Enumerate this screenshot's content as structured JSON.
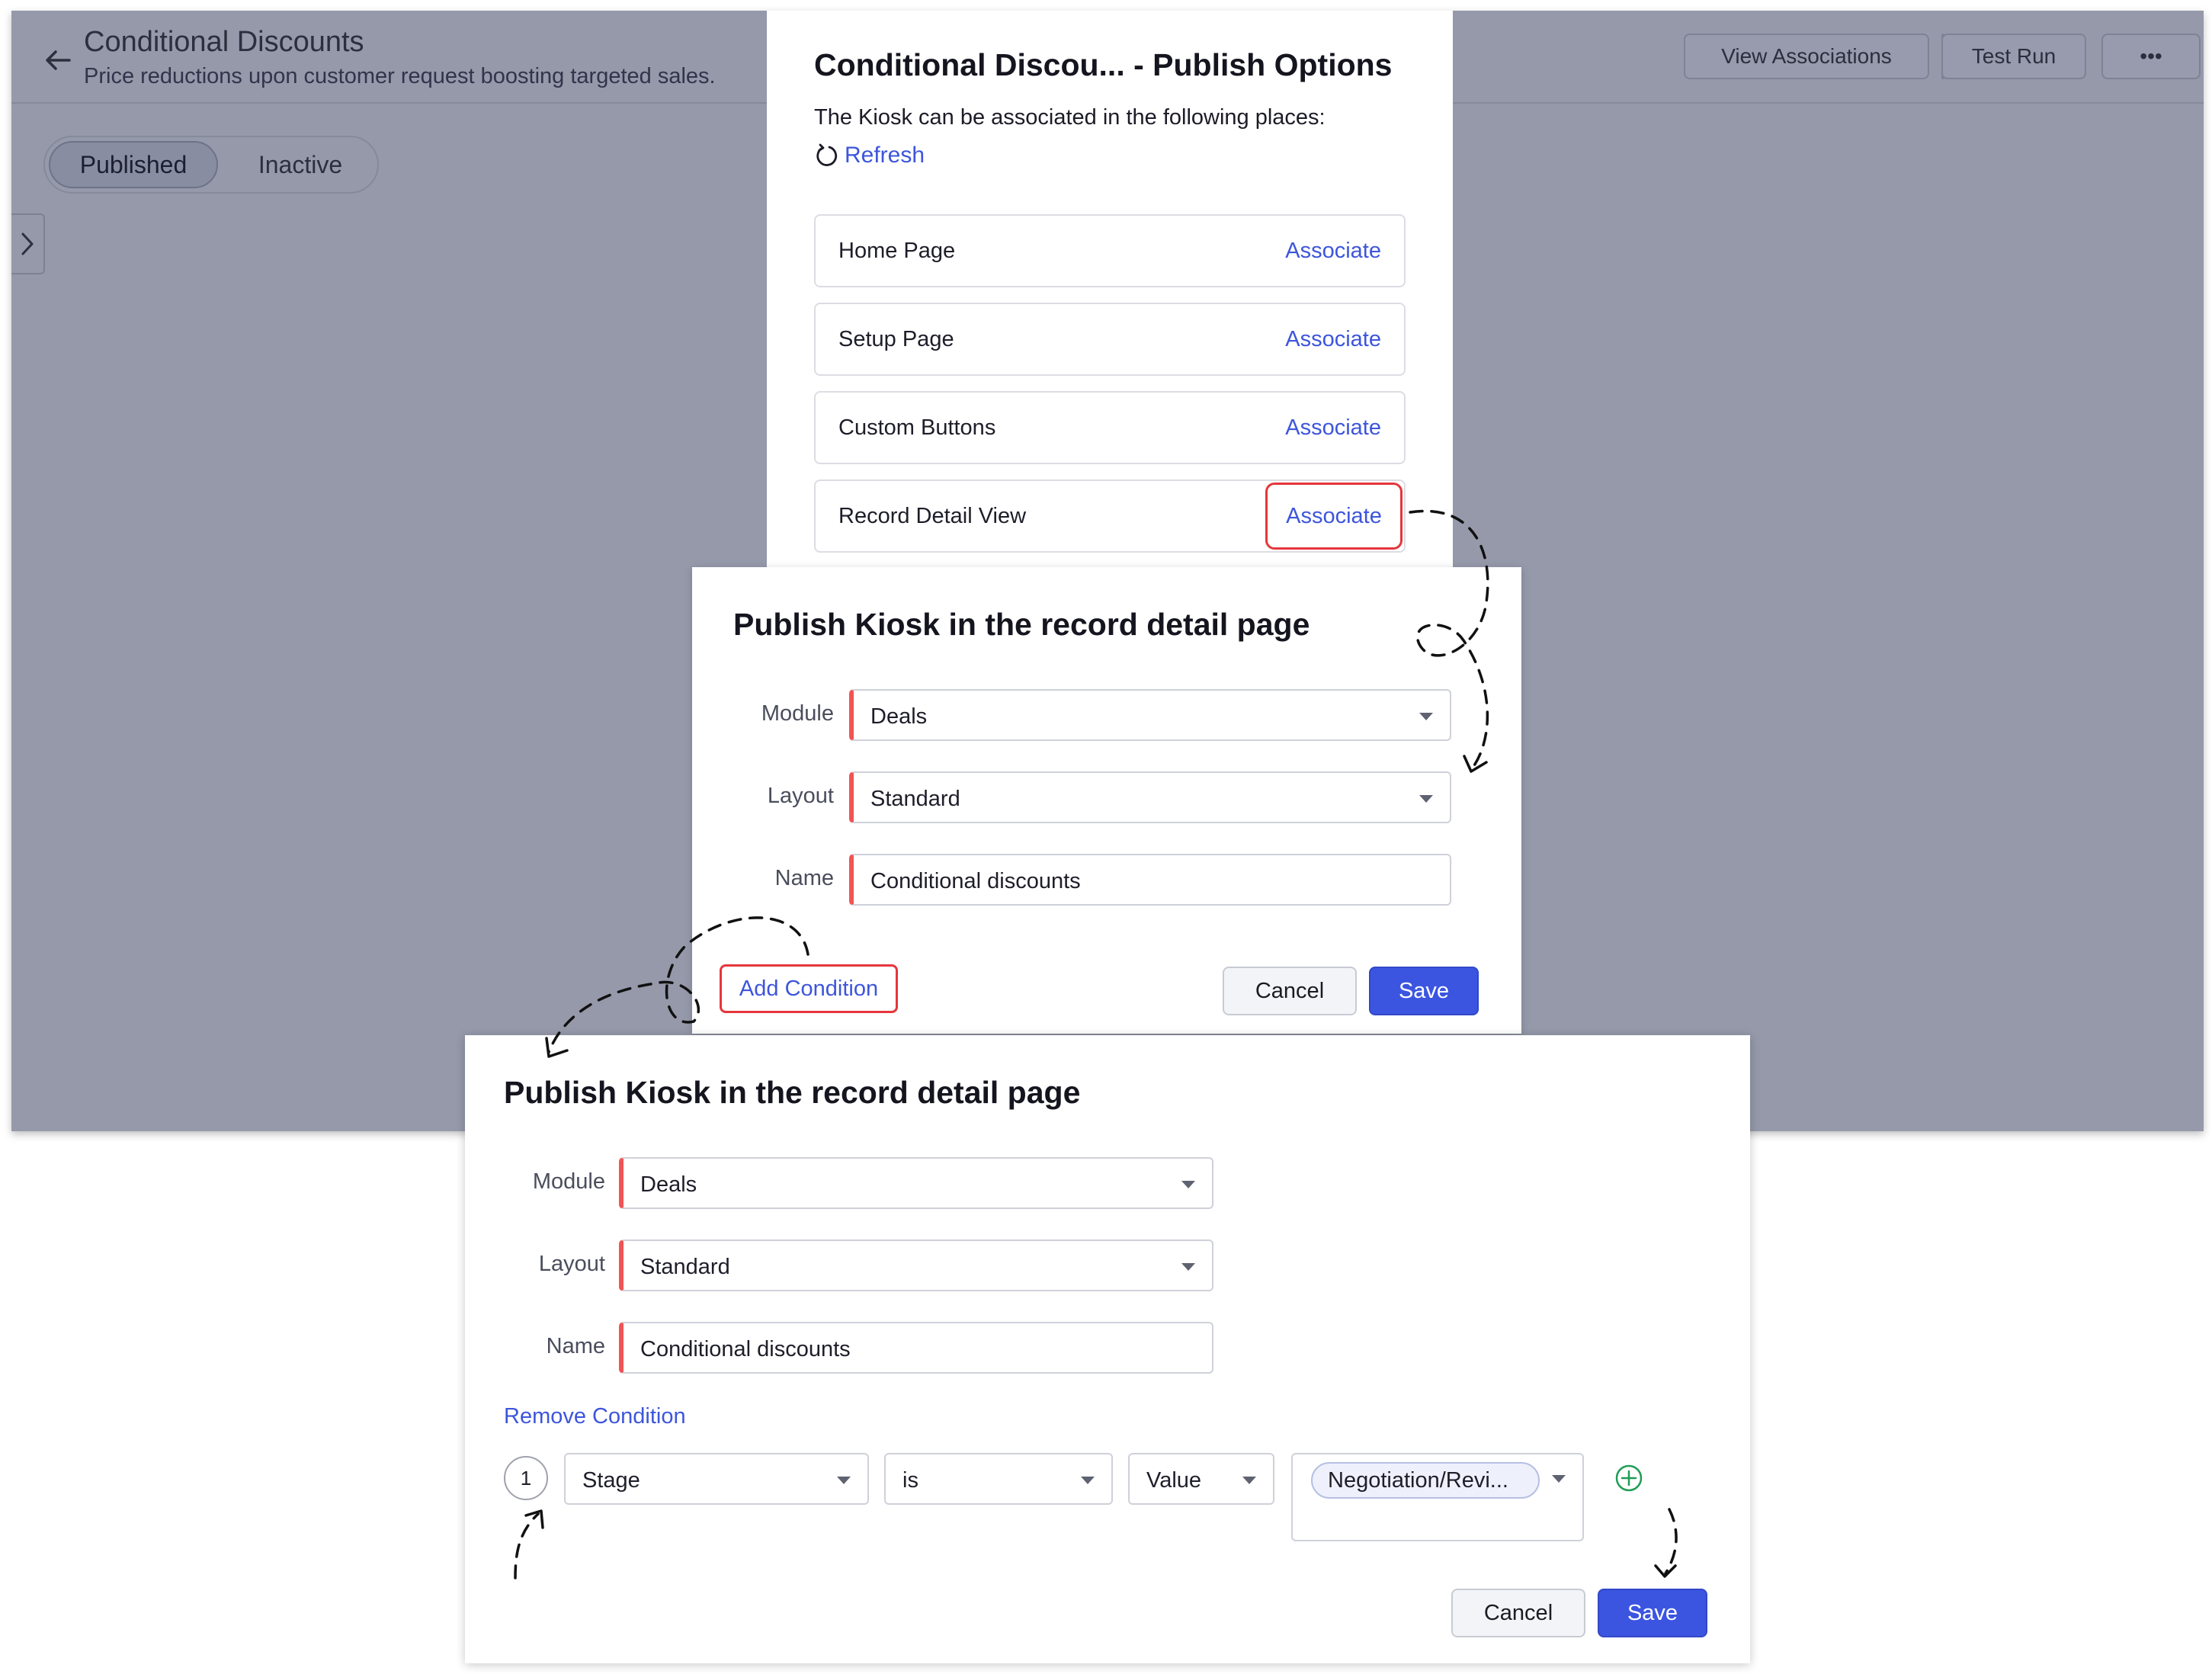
{
  "background_app": {
    "title": "Conditional Discounts",
    "subtitle": "Price reductions upon customer request boosting targeted sales.",
    "buttons": {
      "view_associations": "View Associations",
      "test_run": "Test Run",
      "more": "•••"
    },
    "status_toggle": {
      "published": "Published",
      "inactive": "Inactive",
      "selected": "Published"
    }
  },
  "publish_options": {
    "title": "Conditional Discou... - Publish Options",
    "description": "The Kiosk can be associated in the following places:",
    "refresh_label": "Refresh",
    "places": [
      {
        "name": "Home Page",
        "action": "Associate"
      },
      {
        "name": "Setup Page",
        "action": "Associate"
      },
      {
        "name": "Custom Buttons",
        "action": "Associate"
      },
      {
        "name": "Record Detail View",
        "action": "Associate"
      }
    ]
  },
  "record_dialog_1": {
    "title": "Publish Kiosk in the record detail page",
    "labels": {
      "module": "Module",
      "layout": "Layout",
      "name": "Name"
    },
    "values": {
      "module": "Deals",
      "layout": "Standard",
      "name": "Conditional discounts"
    },
    "add_condition": "Add Condition",
    "cancel": "Cancel",
    "save": "Save"
  },
  "record_dialog_2": {
    "title": "Publish Kiosk in the record detail page",
    "labels": {
      "module": "Module",
      "layout": "Layout",
      "name": "Name"
    },
    "values": {
      "module": "Deals",
      "layout": "Standard",
      "name": "Conditional discounts"
    },
    "remove_condition": "Remove Condition",
    "condition": {
      "index": "1",
      "field": "Stage",
      "operator": "is",
      "value_type": "Value",
      "value": "Negotiation/Revi..."
    },
    "cancel": "Cancel",
    "save": "Save"
  },
  "colors": {
    "accent_blue": "#3b55e1",
    "link_blue": "#3d55dc",
    "required_red": "#f05454",
    "highlight_red": "#e5363c",
    "overlay_gray": "#9599aa",
    "add_green": "#1f9d55"
  },
  "icons": [
    "back-arrow-icon",
    "refresh-icon",
    "chevron-right-icon",
    "dropdown-caret-icon",
    "plus-circle-icon"
  ]
}
